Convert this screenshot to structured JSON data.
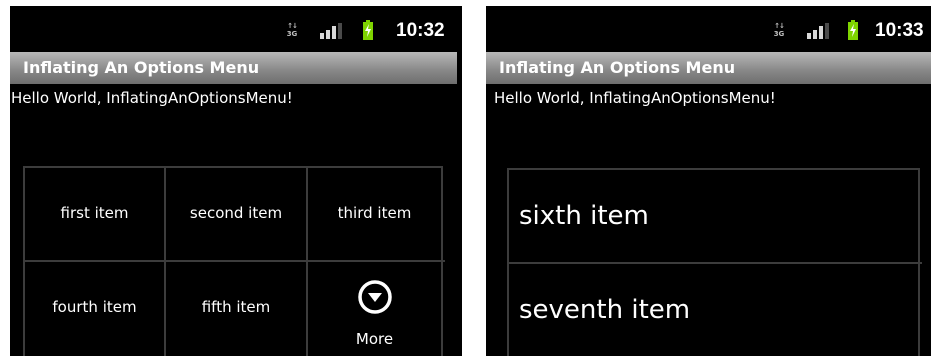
{
  "left_screen": {
    "status_bar": {
      "network_label": "3G",
      "time": "10:32"
    },
    "title": "Inflating An Options Menu",
    "hello_text": "Hello World, InflatingAnOptionsMenu!",
    "options_menu": {
      "items": [
        "first item",
        "second item",
        "third item",
        "fourth item",
        "fifth item"
      ],
      "more": {
        "label": "More",
        "icon": "more-circle-chevron-down-icon"
      }
    }
  },
  "right_screen": {
    "status_bar": {
      "network_label": "3G",
      "time": "10:33"
    },
    "title": "Inflating An Options Menu",
    "hello_text": "Hello World, InflatingAnOptionsMenu!",
    "expanded_menu": {
      "items": [
        "sixth item",
        "seventh item"
      ]
    }
  },
  "colors": {
    "background": "#000000",
    "title_bar": "#8a8a8a",
    "text": "#ffffff",
    "divider": "#3c3c3c",
    "battery_green": "#7fd400"
  }
}
